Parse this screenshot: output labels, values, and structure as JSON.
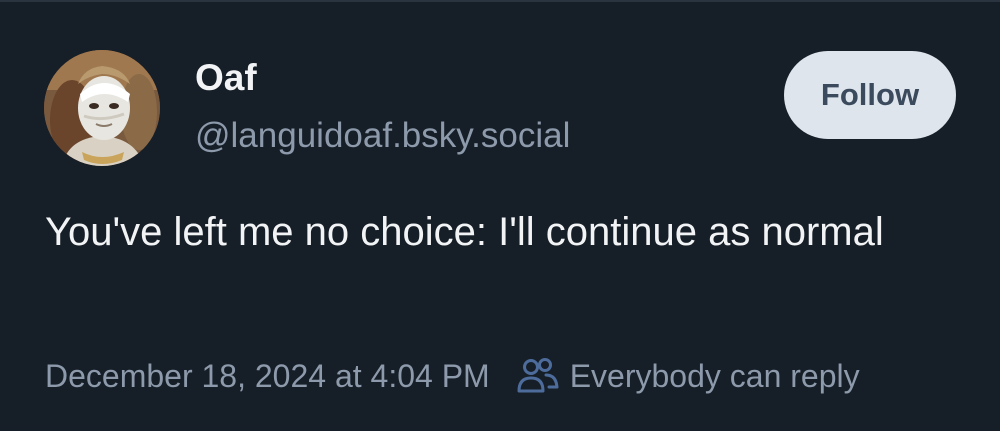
{
  "author": {
    "display_name": "Oaf",
    "handle": "@languidoaf.bsky.social",
    "avatar_icon": "avatar-image"
  },
  "follow": {
    "label": "Follow"
  },
  "post": {
    "text": "You've left me no choice: I'll continue as normal"
  },
  "meta": {
    "timestamp": "December 18, 2024 at 4:04 PM",
    "reply_icon": "people-icon",
    "reply_setting": "Everybody can reply"
  },
  "colors": {
    "background": "#161e27",
    "text_primary": "#f1f3f5",
    "text_secondary": "#8d9aab",
    "follow_button_bg": "#dfe5ec",
    "follow_button_text": "#3b4a5c",
    "accent_icon": "#4d6c9b"
  }
}
